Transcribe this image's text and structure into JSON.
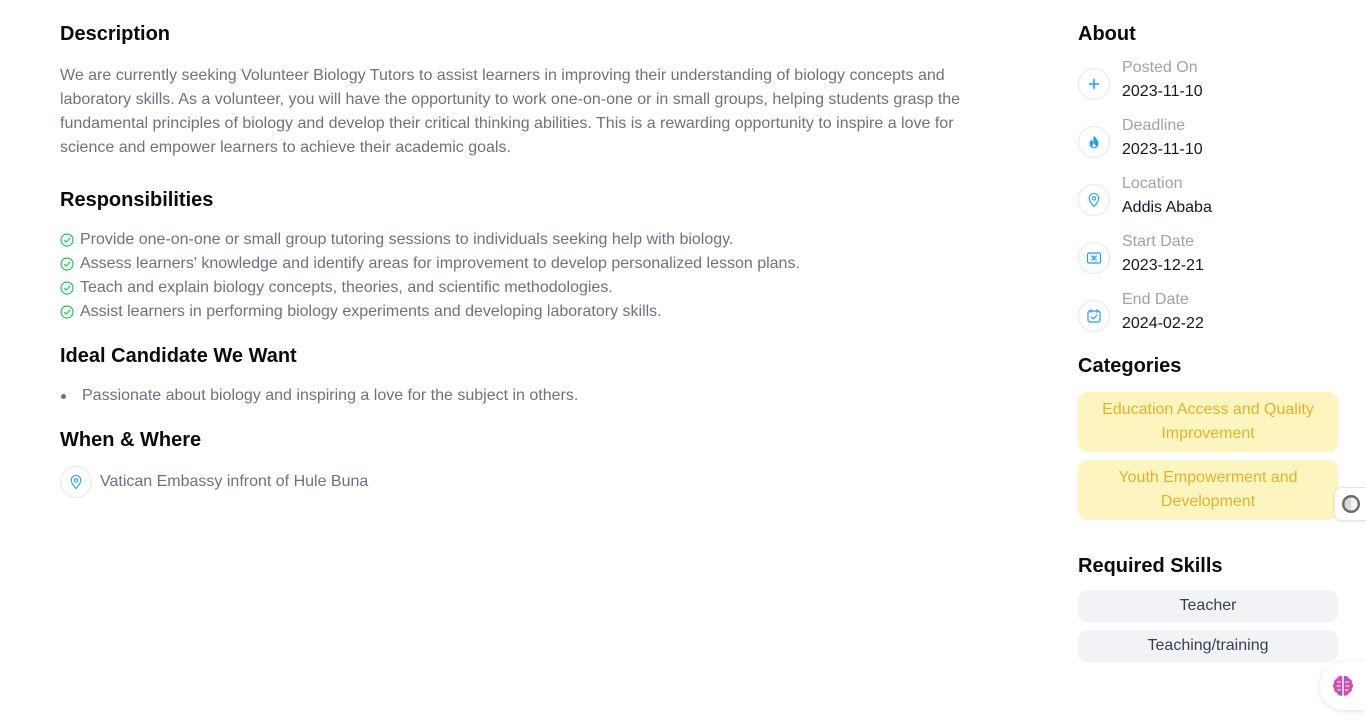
{
  "description": {
    "title": "Description",
    "text": "We are currently seeking Volunteer Biology Tutors to assist learners in improving their understanding of biology concepts and laboratory skills. As a volunteer, you will have the opportunity to work one-on-one or in small groups, helping students grasp the fundamental principles of biology and develop their critical thinking abilities. This is a rewarding opportunity to inspire a love for science and empower learners to achieve their academic goals."
  },
  "responsibilities": {
    "title": "Responsibilities",
    "items": [
      "Provide one-on-one or small group tutoring sessions to individuals seeking help with biology.",
      "Assess learners' knowledge and identify areas for improvement to develop personalized lesson plans.",
      "Teach and explain biology concepts, theories, and scientific methodologies.",
      "Assist learners in performing biology experiments and developing laboratory skills."
    ]
  },
  "ideal": {
    "title": "Ideal Candidate We Want",
    "items": [
      "Passionate about biology and inspiring a love for the subject in others."
    ]
  },
  "when_where": {
    "title": "When & Where",
    "location": "Vatican Embassy infront of Hule Buna"
  },
  "about": {
    "title": "About",
    "items": [
      {
        "label": "Posted On",
        "value": "2023-11-10",
        "icon": "plus-circle-icon"
      },
      {
        "label": "Deadline",
        "value": "2023-11-10",
        "icon": "flame-icon"
      },
      {
        "label": "Location",
        "value": "Addis Ababa",
        "icon": "map-pin-icon"
      },
      {
        "label": "Start Date",
        "value": "2023-12-21",
        "icon": "calendar-start-icon"
      },
      {
        "label": "End Date",
        "value": "2024-02-22",
        "icon": "calendar-check-icon"
      }
    ]
  },
  "categories": {
    "title": "Categories",
    "items": [
      "Education Access and Quality Improvement",
      "Youth Empowerment and Development"
    ]
  },
  "skills": {
    "title": "Required Skills",
    "items": [
      "Teacher",
      "Teaching/training"
    ]
  },
  "colors": {
    "accent": "#1da1f2",
    "check": "#22c55e",
    "category_bg": "#fdf5c0",
    "category_text": "#e2b32a",
    "skill_bg": "#f1f3f7"
  }
}
